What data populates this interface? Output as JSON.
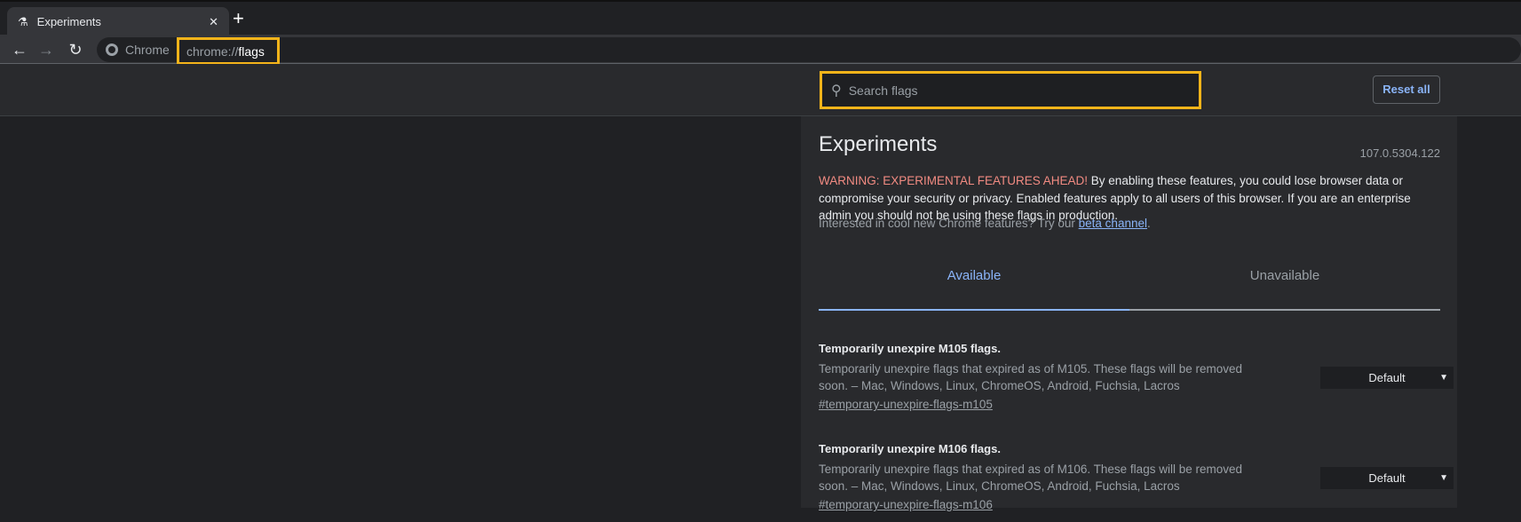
{
  "browser": {
    "tab_title": "Experiments",
    "omnibox_label": "Chrome",
    "url_scheme": "chrome://",
    "url_path": "flags"
  },
  "header": {
    "search_placeholder": "Search flags",
    "reset_label": "Reset all"
  },
  "main": {
    "title": "Experiments",
    "version": "107.0.5304.122",
    "warning_prefix": "WARNING: EXPERIMENTAL FEATURES AHEAD!",
    "warning_text": " By enabling these features, you could lose browser data or compromise your security or privacy. Enabled features apply to all users of this browser. If you are an enterprise admin you should not be using these flags in production.",
    "interest_text": "Interested in cool new Chrome features? Try our ",
    "beta_link": "beta channel",
    "interest_end": ".",
    "tabs": [
      {
        "label": "Available",
        "active": true
      },
      {
        "label": "Unavailable",
        "active": false
      }
    ],
    "flags": [
      {
        "title": "Temporarily unexpire M105 flags.",
        "description": "Temporarily unexpire flags that expired as of M105. These flags will be removed soon. – Mac, Windows, Linux, ChromeOS, Android, Fuchsia, Lacros",
        "link": "#temporary-unexpire-flags-m105",
        "value": "Default"
      },
      {
        "title": "Temporarily unexpire M106 flags.",
        "description": "Temporarily unexpire flags that expired as of M106. These flags will be removed soon. – Mac, Windows, Linux, ChromeOS, Android, Fuchsia, Lacros",
        "link": "#temporary-unexpire-flags-m106",
        "value": "Default"
      }
    ]
  },
  "colors": {
    "highlight": "#f4b41a",
    "accent": "#8ab4f8",
    "warning": "#f28b82"
  }
}
